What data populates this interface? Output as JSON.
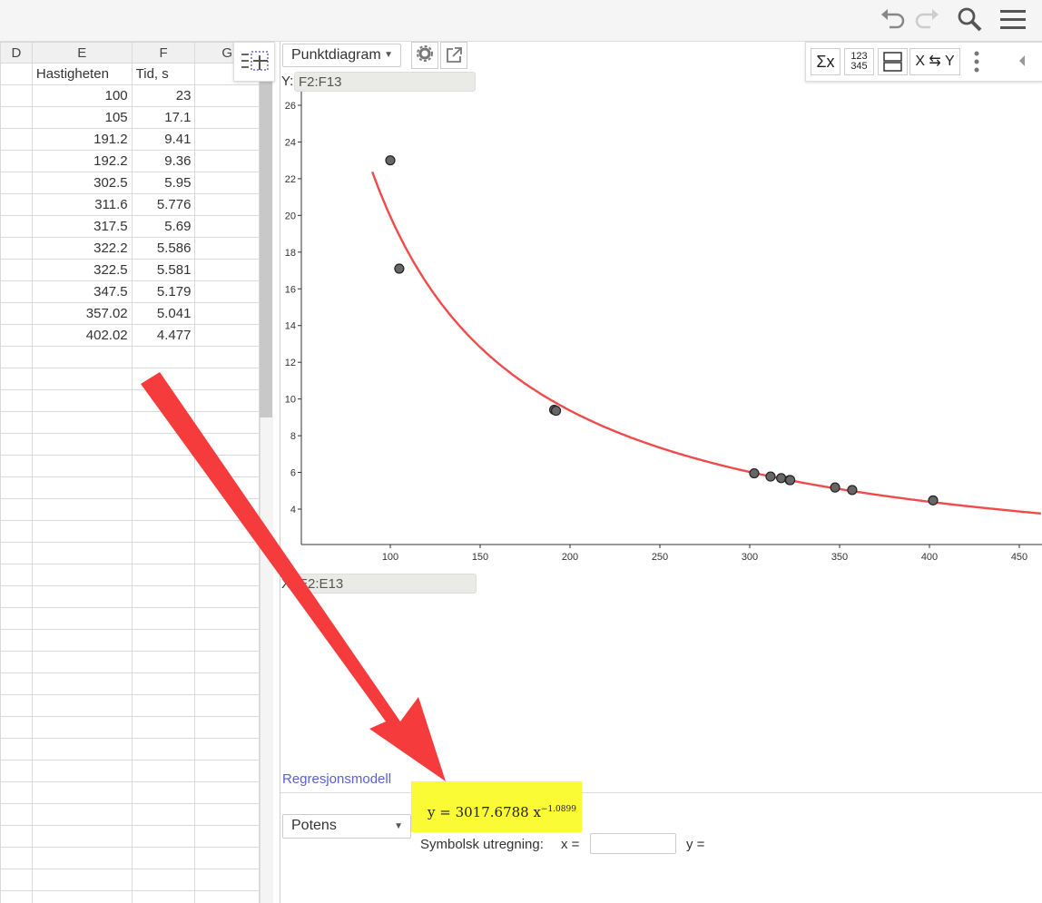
{
  "spreadsheet": {
    "columns": [
      "D",
      "E",
      "F",
      "G"
    ],
    "header_row": [
      "",
      "Hastigheten",
      "Tid, s",
      ""
    ],
    "rows": [
      [
        "",
        "100",
        "23",
        ""
      ],
      [
        "",
        "105",
        "17.1",
        ""
      ],
      [
        "",
        "191.2",
        "9.41",
        ""
      ],
      [
        "",
        "192.2",
        "9.36",
        ""
      ],
      [
        "",
        "302.5",
        "5.95",
        ""
      ],
      [
        "",
        "311.6",
        "5.776",
        ""
      ],
      [
        "",
        "317.5",
        "5.69",
        ""
      ],
      [
        "",
        "322.2",
        "5.586",
        ""
      ],
      [
        "",
        "322.5",
        "5.581",
        ""
      ],
      [
        "",
        "347.5",
        "5.179",
        ""
      ],
      [
        "",
        "357.02",
        "5.041",
        ""
      ],
      [
        "",
        "402.02",
        "4.477",
        ""
      ]
    ],
    "empty_rows": 26
  },
  "toolbar": {
    "plot_type": "Punktdiagram",
    "tools": [
      "Σx",
      "123\n345",
      "",
      "X ⇆ Y"
    ]
  },
  "y_field": {
    "label": "Y:",
    "value": "F2:F13"
  },
  "x_field": {
    "label": "X:",
    "value": "E2:E13"
  },
  "regression": {
    "title": "Regresjonsmodell",
    "model": "Potens",
    "equation_main": "y = 3017.6788 x",
    "equation_exp": "−1.0899",
    "symbolic_label": "Symbolsk utregning:",
    "x_label": "x =",
    "y_label": "y ="
  },
  "colors": {
    "curve": "#f04a4a",
    "arrow": "#f53b3b",
    "highlight": "#fbfb35",
    "link": "#5b5ed6"
  },
  "chart_data": {
    "type": "scatter",
    "x": [
      100,
      105,
      191.2,
      192.2,
      302.5,
      311.6,
      317.5,
      322.2,
      322.5,
      347.5,
      357.02,
      402.02
    ],
    "y": [
      23,
      17.1,
      9.41,
      9.36,
      5.95,
      5.776,
      5.69,
      5.586,
      5.581,
      5.179,
      5.041,
      4.477
    ],
    "fit": {
      "model": "power",
      "a": 3017.6788,
      "b": -1.0899
    },
    "xticks": [
      100,
      150,
      200,
      250,
      300,
      350,
      400,
      450
    ],
    "yticks": [
      4,
      6,
      8,
      10,
      12,
      14,
      16,
      18,
      20,
      22,
      24,
      26
    ],
    "xlim": [
      50,
      460
    ],
    "ylim": [
      2,
      27
    ]
  }
}
